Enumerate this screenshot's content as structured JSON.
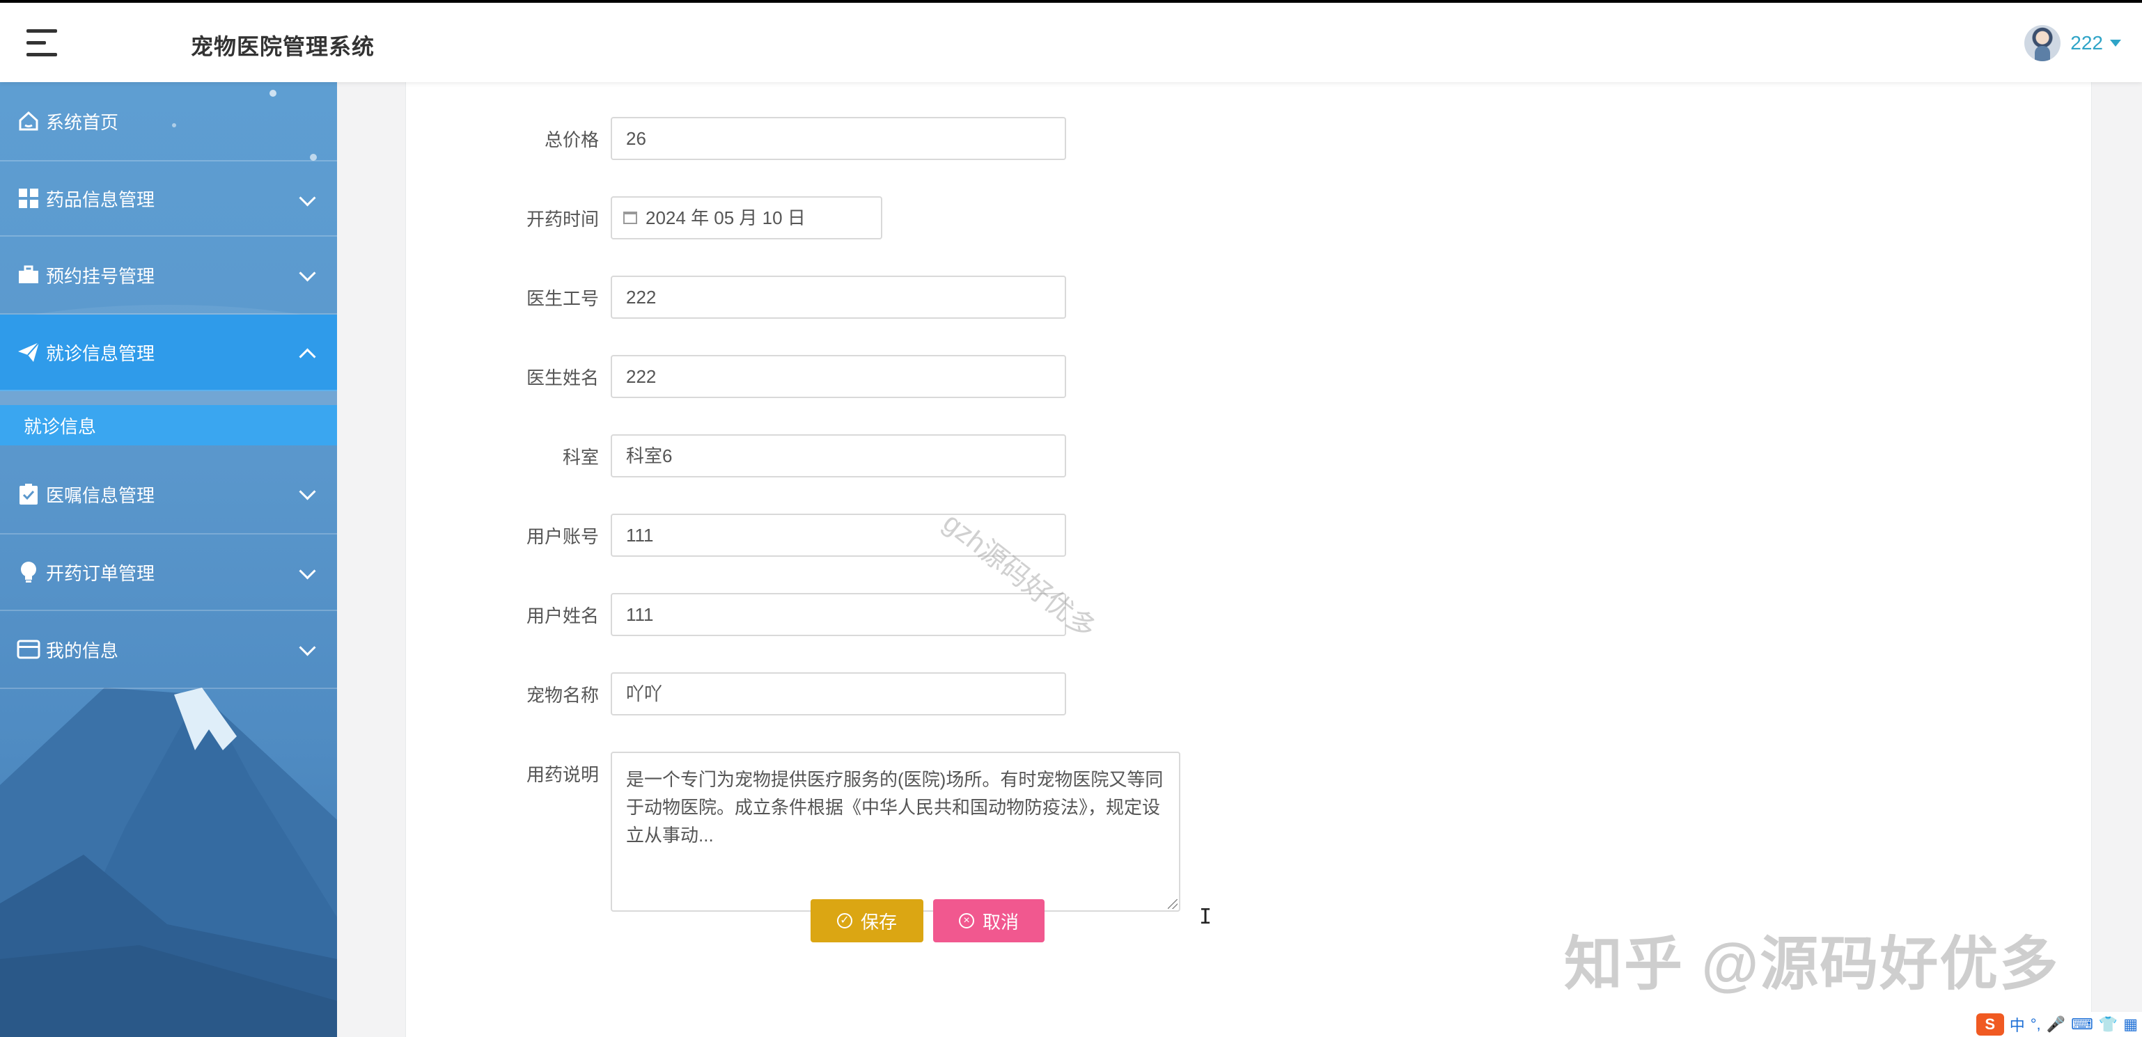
{
  "header": {
    "app_title": "宠物医院管理系统",
    "user_name": "222"
  },
  "sidebar": {
    "items": [
      {
        "label": "系统首页",
        "icon": "home-icon"
      },
      {
        "label": "药品信息管理",
        "icon": "grid-icon"
      },
      {
        "label": "预约挂号管理",
        "icon": "briefcase-icon"
      },
      {
        "label": "就诊信息管理",
        "icon": "paper-plane-icon"
      },
      {
        "label": "医嘱信息管理",
        "icon": "clipboard-check-icon"
      },
      {
        "label": "开药订单管理",
        "icon": "lightbulb-icon"
      },
      {
        "label": "我的信息",
        "icon": "card-icon"
      }
    ],
    "sub_item": "就诊信息"
  },
  "form": {
    "total_price": {
      "label": "总价格",
      "value": "26"
    },
    "prescribe_time": {
      "label": "开药时间",
      "value": "2024 年 05 月 10 日"
    },
    "doctor_id": {
      "label": "医生工号",
      "value": "222"
    },
    "doctor_name": {
      "label": "医生姓名",
      "value": "222"
    },
    "department": {
      "label": "科室",
      "value": "科室6"
    },
    "user_account": {
      "label": "用户账号",
      "value": "111"
    },
    "user_name": {
      "label": "用户姓名",
      "value": "111"
    },
    "pet_name": {
      "label": "宠物名称",
      "value": "吖吖"
    },
    "usage": {
      "label": "用药说明",
      "value": "是一个专门为宠物提供医疗服务的(医院)场所。有时宠物医院又等同于动物医院。成立条件根据《中华人民共和国动物防疫法》，规定设立从事动..."
    }
  },
  "buttons": {
    "save": "保存",
    "cancel": "取消"
  },
  "watermarks": {
    "diagonal": "gzh源码好优多",
    "corner": "知乎 @源码好优多"
  },
  "ime": {
    "lang": "中"
  },
  "colors": {
    "sidebar_active": "#2f9bea",
    "save": "#dba613",
    "cancel": "#f1588f",
    "user_accent": "#2fa4c7"
  }
}
